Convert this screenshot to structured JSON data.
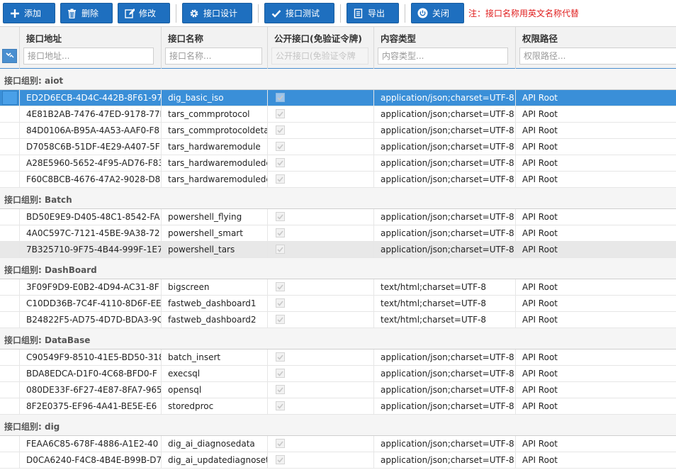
{
  "toolbar": {
    "buttons": [
      {
        "label": "添加",
        "icon": "plus-icon"
      },
      {
        "label": "删除",
        "icon": "trash-icon"
      },
      {
        "label": "修改",
        "icon": "edit-icon"
      },
      {
        "label": "接口设计",
        "icon": "gear-icon"
      },
      {
        "label": "接口测试",
        "icon": "check-icon"
      },
      {
        "label": "导出",
        "icon": "document-icon"
      },
      {
        "label": "关闭",
        "icon": "power-icon"
      }
    ],
    "note": "注：接口名称用英文名称代替"
  },
  "columns": [
    {
      "title": "接口地址",
      "placeholder": "接口地址..."
    },
    {
      "title": "接口名称",
      "placeholder": "接口名称..."
    },
    {
      "title": "公开接口(免验证令牌)",
      "placeholder": "公开接口(免验证令牌"
    },
    {
      "title": "内容类型",
      "placeholder": "内容类型..."
    },
    {
      "title": "权限路径",
      "placeholder": "权限路径..."
    }
  ],
  "groups": [
    {
      "label": "接口组别: aiot",
      "rows": [
        {
          "addr": "ED2D6ECB-4D4C-442B-8F61-97",
          "name": "dig_basic_iso",
          "ctype": "application/json;charset=UTF-8",
          "path": "API Root"
        },
        {
          "addr": "4E81B2AB-7476-47ED-9178-77F",
          "name": "tars_commprotocol",
          "ctype": "application/json;charset=UTF-8",
          "path": "API Root"
        },
        {
          "addr": "84D0106A-B95A-4A53-AAF0-F8",
          "name": "tars_commprotocoldetai",
          "ctype": "application/json;charset=UTF-8",
          "path": "API Root"
        },
        {
          "addr": "D7058C6B-51DF-4E29-A407-5F",
          "name": "tars_hardwaremodule",
          "ctype": "application/json;charset=UTF-8",
          "path": "API Root"
        },
        {
          "addr": "A28E5960-5652-4F95-AD76-F83",
          "name": "tars_hardwaremodulede",
          "ctype": "application/json;charset=UTF-8",
          "path": "API Root"
        },
        {
          "addr": "F60C8BCB-4676-47A2-9028-D8",
          "name": "tars_hardwaremodulede",
          "ctype": "application/json;charset=UTF-8",
          "path": "API Root"
        }
      ]
    },
    {
      "label": "接口组别: Batch",
      "rows": [
        {
          "addr": "BD50E9E9-D405-48C1-8542-FA",
          "name": "powershell_flying",
          "ctype": "application/json;charset=UTF-8",
          "path": "API Root"
        },
        {
          "addr": "4A0C597C-7121-45BE-9A38-72",
          "name": "powershell_smart",
          "ctype": "application/json;charset=UTF-8",
          "path": "API Root"
        },
        {
          "addr": "7B325710-9F75-4B44-999F-1E7",
          "name": "powershell_tars",
          "ctype": "application/json;charset=UTF-8",
          "path": "API Root"
        }
      ]
    },
    {
      "label": "接口组别: DashBoard",
      "rows": [
        {
          "addr": "3F09F9D9-E0B2-4D94-AC31-8F",
          "name": "bigscreen",
          "ctype": "text/html;charset=UTF-8",
          "path": "API Root"
        },
        {
          "addr": "C10DD36B-7C4F-4110-8D6F-EE",
          "name": "fastweb_dashboard1",
          "ctype": "text/html;charset=UTF-8",
          "path": "API Root"
        },
        {
          "addr": "B24822F5-AD75-4D7D-BDA3-9C",
          "name": "fastweb_dashboard2",
          "ctype": "text/html;charset=UTF-8",
          "path": "API Root"
        }
      ]
    },
    {
      "label": "接口组别: DataBase",
      "rows": [
        {
          "addr": "C90549F9-8510-41E5-BD50-318",
          "name": "batch_insert",
          "ctype": "application/json;charset=UTF-8",
          "path": "API Root"
        },
        {
          "addr": "BDA8EDCA-D1F0-4C68-BFD0-F",
          "name": "execsql",
          "ctype": "application/json;charset=UTF-8",
          "path": "API Root"
        },
        {
          "addr": "080DE33F-6F27-4E87-8FA7-965",
          "name": "opensql",
          "ctype": "application/json;charset=UTF-8",
          "path": "API Root"
        },
        {
          "addr": "8F2E0375-EF96-4A41-BE5E-E6",
          "name": "storedproc",
          "ctype": "application/json;charset=UTF-8",
          "path": "API Root"
        }
      ]
    },
    {
      "label": "接口组别: dig",
      "rows": [
        {
          "addr": "FEAA6C85-678F-4886-A1E2-40",
          "name": "dig_ai_diagnosedata",
          "ctype": "application/json;charset=UTF-8",
          "path": "API Root"
        },
        {
          "addr": "D0CA6240-F4C8-4B4E-B99B-D7",
          "name": "dig_ai_updatediagnoset",
          "ctype": "application/json;charset=UTF-8",
          "path": "API Root"
        }
      ]
    }
  ],
  "colors": {
    "primary": "#1e6fbf",
    "selected_row": "#3a8fd8",
    "note": "#e02020"
  }
}
